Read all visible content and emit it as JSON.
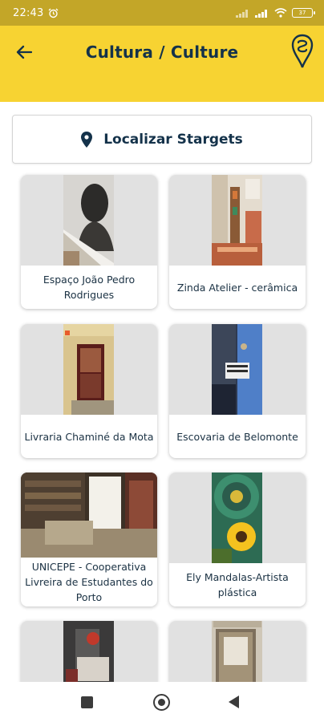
{
  "status": {
    "time": "22:43",
    "battery": "37"
  },
  "header": {
    "title": "Cultura / Culture"
  },
  "locate_button": {
    "label": "Localizar Stargets"
  },
  "places": [
    {
      "name": "Espaço João Pedro Rodrigues",
      "photo": "bust-sculpture"
    },
    {
      "name": "Zinda Atelier - cerâmica",
      "photo": "ceramic-shop-interior"
    },
    {
      "name": "Livraria Chaminé da Mota",
      "photo": "bookshop-facade"
    },
    {
      "name": "Escovaria de Belomonte",
      "photo": "street-sign"
    },
    {
      "name": "UNICEPE - Cooperativa Livreira de Estudantes do Porto",
      "photo": "bookstore-shelves"
    },
    {
      "name": "Ely Mandalas-Artista plástica",
      "photo": "mandala-sunflower"
    },
    {
      "name": "",
      "photo": "gallery-interior"
    },
    {
      "name": "",
      "photo": "shop-doorway"
    }
  ],
  "colors": {
    "accent": "#f7d332",
    "navy": "#14324a"
  }
}
